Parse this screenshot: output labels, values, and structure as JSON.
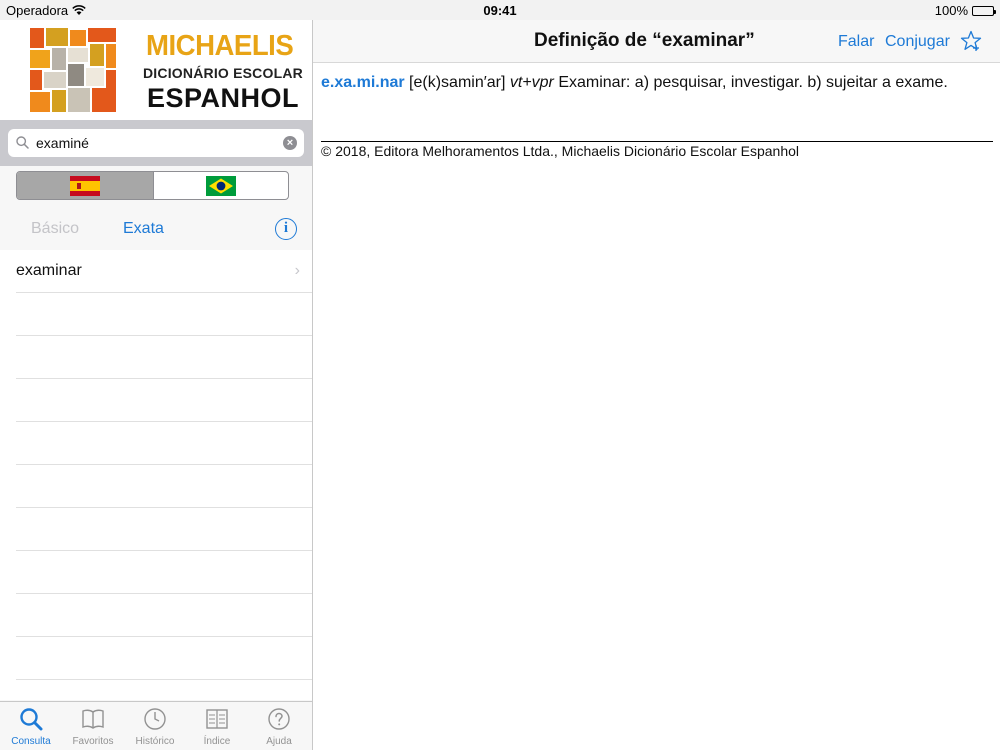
{
  "status_bar": {
    "carrier": "Operadora",
    "time": "09:41",
    "battery": "100%"
  },
  "brand": {
    "line1": "MICHAELIS",
    "line2": "DICIONÁRIO ESCOLAR",
    "line3": "ESPANHOL",
    "accent_color": "#e8a416"
  },
  "search": {
    "value": "examiné",
    "clear_icon": "clear-circle-icon"
  },
  "language_toggle": {
    "options": [
      {
        "flag": "spain-flag-icon",
        "selected": true
      },
      {
        "flag": "brazil-flag-icon",
        "selected": false
      }
    ]
  },
  "modes": {
    "basic_label": "Básico",
    "exact_label": "Exata",
    "selected": "Exata"
  },
  "results": {
    "items": [
      {
        "label": "examinar"
      }
    ]
  },
  "tabbar": {
    "items": [
      {
        "label": "Consulta",
        "icon": "search-icon",
        "active": true
      },
      {
        "label": "Favoritos",
        "icon": "book-icon",
        "active": false
      },
      {
        "label": "Histórico",
        "icon": "clock-icon",
        "active": false
      },
      {
        "label": "Índice",
        "icon": "index-icon",
        "active": false
      },
      {
        "label": "Ajuda",
        "icon": "help-icon",
        "active": false
      }
    ]
  },
  "detail": {
    "title": "Definição de “examinar”",
    "speak_label": "Falar",
    "conjugate_label": "Conjugar",
    "headword": "e.xa.mi.nar",
    "pronunciation": " [e(k)samin′ar] ",
    "grammar": "vt+vpr",
    "definition_text": " Examinar: a) pesquisar, investigar. b) sujeitar a exame.",
    "copyright": "© 2018, Editora Melhoramentos Ltda., Michaelis Dicionário Escolar Espanhol"
  },
  "colors": {
    "accent": "#1e7ad6",
    "inactive": "#929292"
  }
}
